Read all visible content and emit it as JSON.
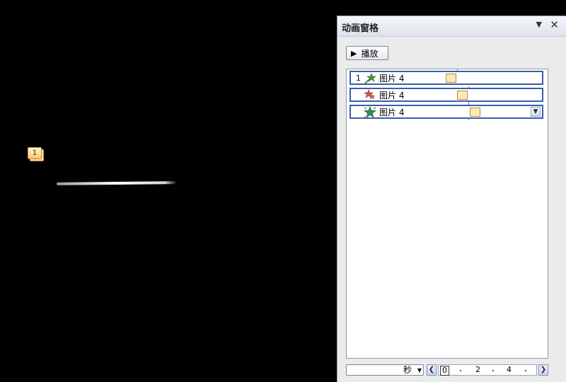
{
  "slide": {
    "animation_tag_number": "1"
  },
  "pane": {
    "title": "动画窗格",
    "menu_icon": "▼",
    "close_icon": "✕",
    "play_button": {
      "icon": "▶",
      "label": "播放"
    },
    "items": [
      {
        "order": "1",
        "icon": "motion-path-icon",
        "label": "图片 4"
      },
      {
        "order": "",
        "icon": "star-entrance-icon",
        "label": "图片 4"
      },
      {
        "order": "",
        "icon": "star-emphasis-icon",
        "label": "图片 4"
      }
    ],
    "timeline": {
      "unit": "秒",
      "ticks": [
        "0",
        "2",
        "4"
      ]
    }
  }
}
